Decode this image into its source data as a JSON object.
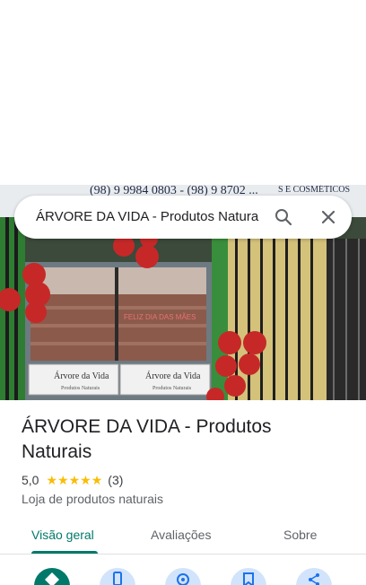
{
  "search": {
    "query": "ÁRVORE DA VIDA - Produtos Natura"
  },
  "photo": {
    "sign_top_text": "(98) 9 9984 0803 - (98) 9 8702 ...",
    "sign_right_text": "S E COSMÉTICOS",
    "window_sticker_1": "Árvore da Vida",
    "window_sticker_1_sub": "Produtos Naturais",
    "window_sticker_2": "Árvore da Vida",
    "window_sticker_2_sub": "Produtos Naturais",
    "window_banner": "FELIZ DIA DAS MÃES"
  },
  "place": {
    "title": "ÁRVORE DA VIDA - Produtos Naturais",
    "rating": "5,0",
    "stars": 5,
    "review_count": "(3)",
    "category": "Loja de produtos naturais"
  },
  "tabs": [
    {
      "label": "Visão geral",
      "active": true
    },
    {
      "label": "Avaliações",
      "active": false
    },
    {
      "label": "Sobre",
      "active": false
    }
  ],
  "actions": [
    {
      "icon": "directions-icon",
      "primary": true
    },
    {
      "icon": "phone-icon",
      "primary": false
    },
    {
      "icon": "website-icon",
      "primary": false
    },
    {
      "icon": "save-icon",
      "primary": false
    },
    {
      "icon": "share-icon",
      "primary": false
    }
  ],
  "colors": {
    "accent": "#00796b",
    "star": "#fbbc04",
    "action_bg": "#d2e3fc"
  }
}
